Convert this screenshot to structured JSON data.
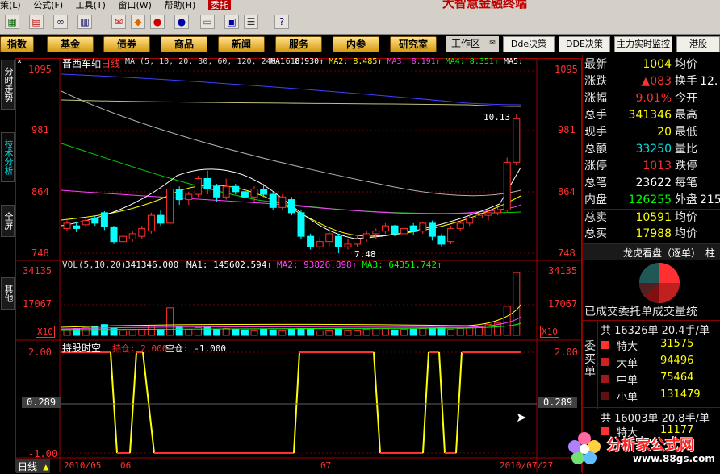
{
  "menubar": {
    "items": [
      "策(L)",
      "公式(F)",
      "工具(T)",
      "窗口(W)",
      "帮助(H)"
    ],
    "active": "委托",
    "brand": "大智慧金融终端"
  },
  "toolbar": {
    "icons": [
      "market-board-icon",
      "rank-icon",
      "binoculars-icon",
      "report-icon",
      "mail-icon",
      "diamond-icon",
      "f10-icon",
      "info-icon",
      "separator",
      "notes-icon",
      "window-icon",
      "list-icon",
      "help-cursor-icon"
    ]
  },
  "nav": {
    "buttons": [
      "指数",
      "基金",
      "债券",
      "商品",
      "新闻",
      "服务",
      "内参",
      "研究室"
    ],
    "workspace_label": "工作区",
    "right_buttons": [
      "Dde决策",
      "DDE决策",
      "主力实时监控",
      "港股"
    ]
  },
  "left_tabs": [
    "分时走势",
    "技术分析",
    "全屏",
    "其他"
  ],
  "chart": {
    "stock_name": "晋西车轴",
    "period": "日线",
    "ma_params": "MA (5, 10, 20, 30, 60, 120, 240, 610)",
    "ma_values": [
      {
        "label": "MA1:",
        "value": "8.930",
        "color": "#ffffff"
      },
      {
        "label": "MA2:",
        "value": "8.485",
        "color": "#ffff00"
      },
      {
        "label": "MA3:",
        "value": "8.191",
        "color": "#ff40ff"
      },
      {
        "label": "MA4:",
        "value": "8.351",
        "color": "#00ff00"
      },
      {
        "label": "MA5:",
        "value": "",
        "color": "#ffffff"
      }
    ],
    "price_axis": [
      "1095",
      "981",
      "864",
      "748"
    ],
    "high_marker": "10.13",
    "low_marker": "7.48",
    "vol_header": "VOL(5,10,20)",
    "vol_value": "341346.000",
    "vol_ma": [
      {
        "label": "MA1:",
        "value": "145602.594",
        "color": "#ffffff"
      },
      {
        "label": "MA2:",
        "value": "93826.898",
        "color": "#ff40ff"
      },
      {
        "label": "MA3:",
        "value": "64351.742",
        "color": "#00ff00"
      }
    ],
    "vol_axis": [
      "34135",
      "17067"
    ],
    "vol_unit": "X10",
    "ind_name": "持股时空",
    "ind_hold": "持仓: 2.000",
    "ind_empty": "空仓: -1.000",
    "ind_axis": [
      "2.00",
      "0.289",
      "-1.00"
    ],
    "x_axis": [
      "日线",
      "2010/05",
      "06",
      "07",
      "2010/07/27"
    ]
  },
  "quote": {
    "rows": [
      {
        "k": "最新",
        "v": "1004",
        "vc": "#ffff00",
        "k2": "均价",
        "v2": ""
      },
      {
        "k": "涨跌",
        "v": "▲083",
        "vc": "#ff3030",
        "k2": "换手",
        "v2": "12."
      },
      {
        "k": "涨幅",
        "v": "9.01%",
        "vc": "#ff3030",
        "k2": "今开",
        "v2": ""
      },
      {
        "k": "总手",
        "v": "341346",
        "vc": "#ffff00",
        "k2": "最高",
        "v2": ""
      },
      {
        "k": "现手",
        "v": "20",
        "vc": "#ffff00",
        "k2": "最低",
        "v2": ""
      },
      {
        "k": "总额",
        "v": "33250",
        "vc": "#00e0e0",
        "k2": "量比",
        "v2": ""
      },
      {
        "k": "涨停",
        "v": "1013",
        "vc": "#ff3030",
        "k2": "跌停",
        "v2": ""
      },
      {
        "k": "总笔",
        "v": "23622",
        "vc": "#ffffff",
        "k2": "每笔",
        "v2": ""
      },
      {
        "k": "内盘",
        "v": "126255",
        "vc": "#00ff00",
        "k2": "外盘",
        "v2": "215"
      },
      {
        "k": "总卖",
        "v": "10591",
        "vc": "#ffff00",
        "k2": "均价",
        "v2": ""
      },
      {
        "k": "总买",
        "v": "17988",
        "vc": "#ffff00",
        "k2": "均价",
        "v2": ""
      }
    ],
    "lhb_title": "龙虎看盘（逐单）",
    "lhb_tab2": "柱",
    "order_title": "已成交委托单成交量统",
    "buy_side": "委买单",
    "buy_total": "共 16326单 20.4手/单",
    "buy_rows": [
      {
        "k": "特大",
        "v": "31575",
        "c": "#ff3030"
      },
      {
        "k": "大单",
        "v": "94496",
        "c": "#d02020"
      },
      {
        "k": "中单",
        "v": "75464",
        "c": "#a01818"
      },
      {
        "k": "小单",
        "v": "131479",
        "c": "#601010"
      }
    ],
    "sell_total": "共 16003单 20.8手/单",
    "sell_row": {
      "k": "特大",
      "v": "11177"
    },
    "watermark": "分析家公式网",
    "watermark_url": "www.88gs.com"
  },
  "colors": {
    "up": "#ff3030",
    "down": "#00ffff",
    "gold": "#e0a020"
  }
}
